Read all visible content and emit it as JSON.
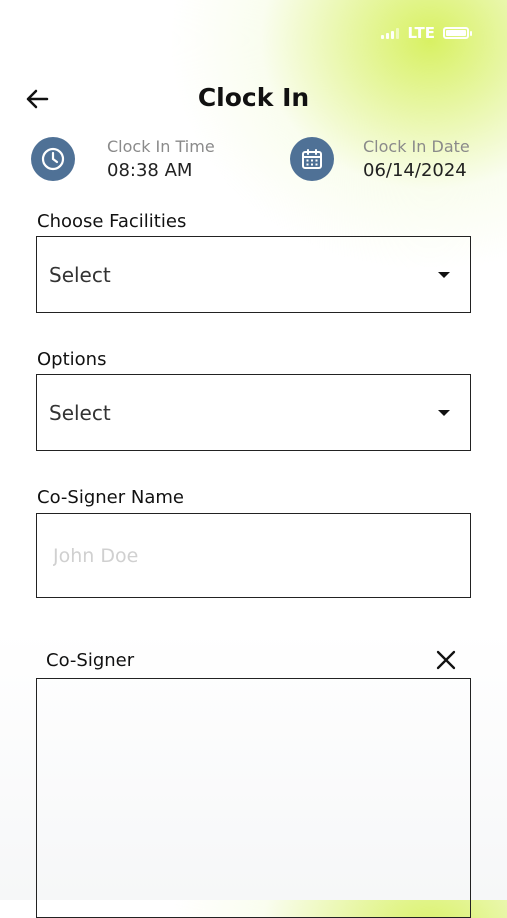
{
  "status_bar": {
    "network": "LTE"
  },
  "header": {
    "title": "Clock In"
  },
  "clock_info": {
    "time_label": "Clock In Time",
    "time_value": "08:38 AM",
    "date_label": "Clock In Date",
    "date_value": "06/14/2024"
  },
  "form": {
    "facilities_label": "Choose Facilities",
    "facilities_value": "Select",
    "options_label": "Options",
    "options_value": "Select",
    "cosigner_name_label": "Co-Signer Name",
    "cosigner_name_placeholder": "John Doe",
    "cosigner_label": "Co-Signer"
  },
  "colors": {
    "accent": "#4f7196",
    "highlight": "#d6f05a"
  },
  "icons": {
    "back": "arrow-left-icon",
    "time": "clock-icon",
    "date": "calendar-icon",
    "dropdown": "caret-down-icon",
    "clear": "close-icon"
  }
}
